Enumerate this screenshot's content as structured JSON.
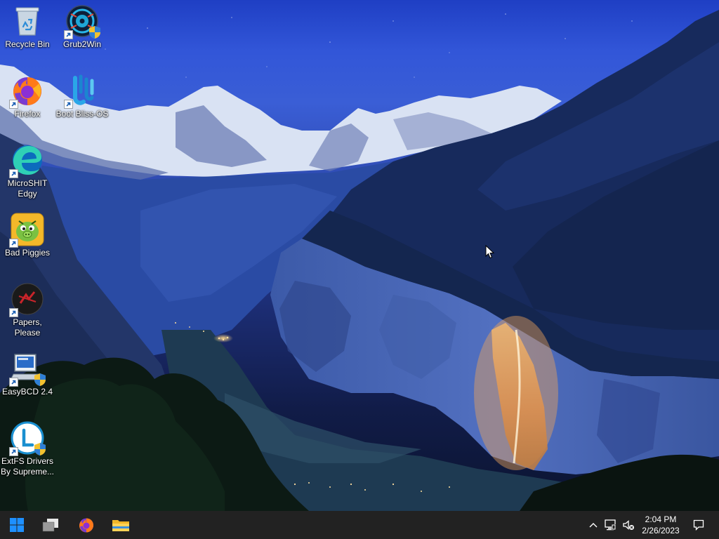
{
  "desktop": {
    "icons": [
      {
        "name": "recycle-bin",
        "label": "Recycle Bin"
      },
      {
        "name": "grub2win",
        "label": "Grub2Win"
      },
      {
        "name": "firefox",
        "label": "Firefox"
      },
      {
        "name": "boot-bliss-os",
        "label": "Boot Bliss-OS"
      },
      {
        "name": "microshit-edgy",
        "label": "MicroSHIT Edgy"
      },
      {
        "name": "bad-piggies",
        "label": "Bad Piggies"
      },
      {
        "name": "papers-please",
        "label": "Papers, Please"
      },
      {
        "name": "easybcd",
        "label": "EasyBCD 2.4"
      },
      {
        "name": "extfs-drivers",
        "label": "ExtFS Drivers By Supreme..."
      }
    ]
  },
  "taskbar": {
    "start_icon": "windows-start-icon",
    "pinned": [
      "task-view-icon",
      "firefox-icon",
      "file-explorer-icon"
    ],
    "tray_icons": [
      "chevron-up-icon",
      "network-icon",
      "volume-muted-icon",
      "action-center-icon"
    ],
    "clock_time": "2:04 PM",
    "clock_date": "2/26/2023",
    "background": "#222222"
  }
}
